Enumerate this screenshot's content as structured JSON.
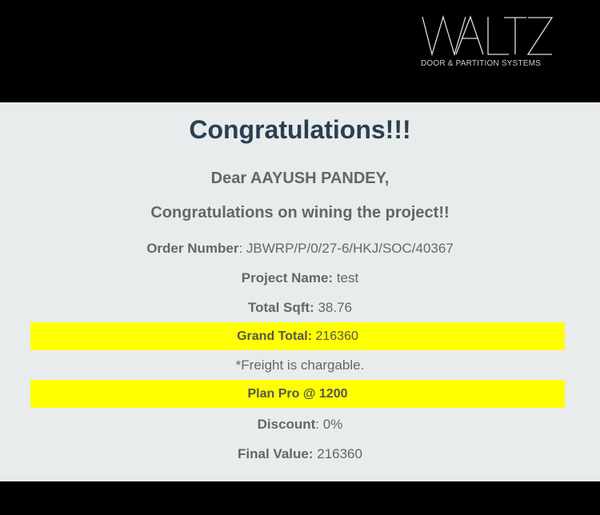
{
  "brand": {
    "logo_text": "WALTZ",
    "tagline": "DOOR & PARTITION SYSTEMS"
  },
  "title": "Congratulations!!!",
  "greeting": "Dear AAYUSH PANDEY,",
  "message": "Congratulations on wining the project!!",
  "order": {
    "label": "Order Number",
    ":": ":",
    "sep": ": ",
    "value": "JBWRP/P/0/27-6/HKJ/SOC/40367"
  },
  "project": {
    "label": "Project Name:",
    "value": " test"
  },
  "sqft": {
    "label": "Total Sqft:",
    "value": " 38.76"
  },
  "grand_total": {
    "label": "Grand Total:",
    "value": " 216360"
  },
  "freight_note": "*Freight is chargable.",
  "plan": "Plan Pro @ 1200",
  "discount": {
    "label": "Discount",
    "sep": ": ",
    "value": "0%"
  },
  "final": {
    "label": "Final Value:",
    "value": " 216360"
  },
  "colors": {
    "highlight": "#ffff00",
    "title": "#2c3e50",
    "panel": "#e8eced"
  }
}
